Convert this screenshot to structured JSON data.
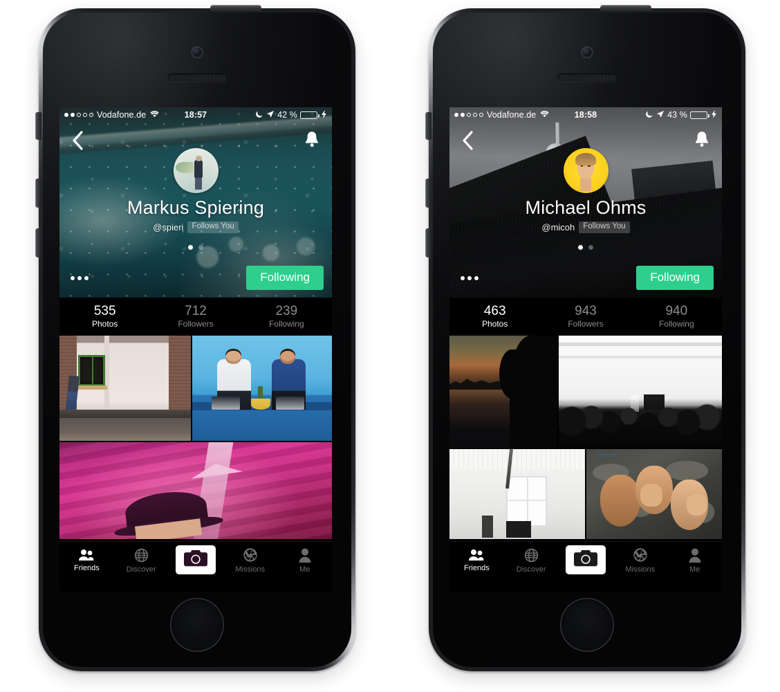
{
  "app": {
    "accent_green": "#2ecf8d",
    "battery_green": "#4cd964",
    "tabs": [
      {
        "key": "friends",
        "label": "Friends",
        "icon": "friends-icon",
        "active": true
      },
      {
        "key": "discover",
        "label": "Discover",
        "icon": "globe-icon",
        "active": false
      },
      {
        "key": "camera",
        "label": "",
        "icon": "camera-icon",
        "active": false
      },
      {
        "key": "missions",
        "label": "Missions",
        "icon": "aperture-icon",
        "active": false
      },
      {
        "key": "me",
        "label": "Me",
        "icon": "person-icon",
        "active": false
      }
    ]
  },
  "phones": [
    {
      "id": "left",
      "status_bar": {
        "signal_dots_filled": 2,
        "signal_dots_total": 5,
        "carrier": "Vodafone.de",
        "wifi_icon": "wifi-icon",
        "time": "18:57",
        "dnd_icon": "moon-icon",
        "location_icon": "location-arrow-icon",
        "battery_percent_label": "42 %",
        "battery_level": 45,
        "charging_icon": "bolt-icon"
      },
      "nav": {
        "back_icon": "chevron-left-icon",
        "notifications_icon": "bell-icon"
      },
      "profile": {
        "avatar_name": "avatar",
        "display_name": "Markus Spiering",
        "handle": "@spieri",
        "follows_you_badge": "Follows You",
        "cover_pages": 2,
        "cover_active_page": 1,
        "more_label": "More options",
        "follow_button_label": "Following"
      },
      "stats": [
        {
          "value": "535",
          "label": "Photos",
          "active": true
        },
        {
          "value": "712",
          "label": "Followers",
          "active": false
        },
        {
          "value": "239",
          "label": "Following",
          "active": false
        }
      ],
      "grid_layout": "two-up-then-wide",
      "photos": [
        {
          "name": "photo-house-window",
          "style": "ph-house"
        },
        {
          "name": "photo-blue-office",
          "style": "ph-blue"
        },
        {
          "name": "photo-pink-portrait",
          "style": "ph-pink"
        }
      ]
    },
    {
      "id": "right",
      "status_bar": {
        "signal_dots_filled": 2,
        "signal_dots_total": 5,
        "carrier": "Vodafone.de",
        "wifi_icon": "wifi-icon",
        "time": "18:58",
        "dnd_icon": "moon-icon",
        "location_icon": "location-arrow-icon",
        "battery_percent_label": "43 %",
        "battery_level": 46,
        "charging_icon": "bolt-icon"
      },
      "nav": {
        "back_icon": "chevron-left-icon",
        "notifications_icon": "bell-icon"
      },
      "profile": {
        "avatar_name": "avatar",
        "display_name": "Michael Ohms",
        "handle": "@micoh",
        "follows_you_badge": "Follows You",
        "cover_pages": 2,
        "cover_active_page": 1,
        "more_label": "More options",
        "follow_button_label": "Following"
      },
      "stats": [
        {
          "value": "463",
          "label": "Photos",
          "active": true
        },
        {
          "value": "943",
          "label": "Followers",
          "active": false
        },
        {
          "value": "940",
          "label": "Following",
          "active": false
        }
      ],
      "grid_layout": "two-by-two",
      "photos": [
        {
          "name": "photo-sunset-silhouette",
          "style": "ph-sunset"
        },
        {
          "name": "photo-white-event-hall",
          "style": "ph-white-event"
        },
        {
          "name": "photo-white-room",
          "style": "ph-white-room"
        },
        {
          "name": "photo-friends-map",
          "style": "ph-map",
          "overlay_text": "21:25"
        }
      ]
    }
  ]
}
